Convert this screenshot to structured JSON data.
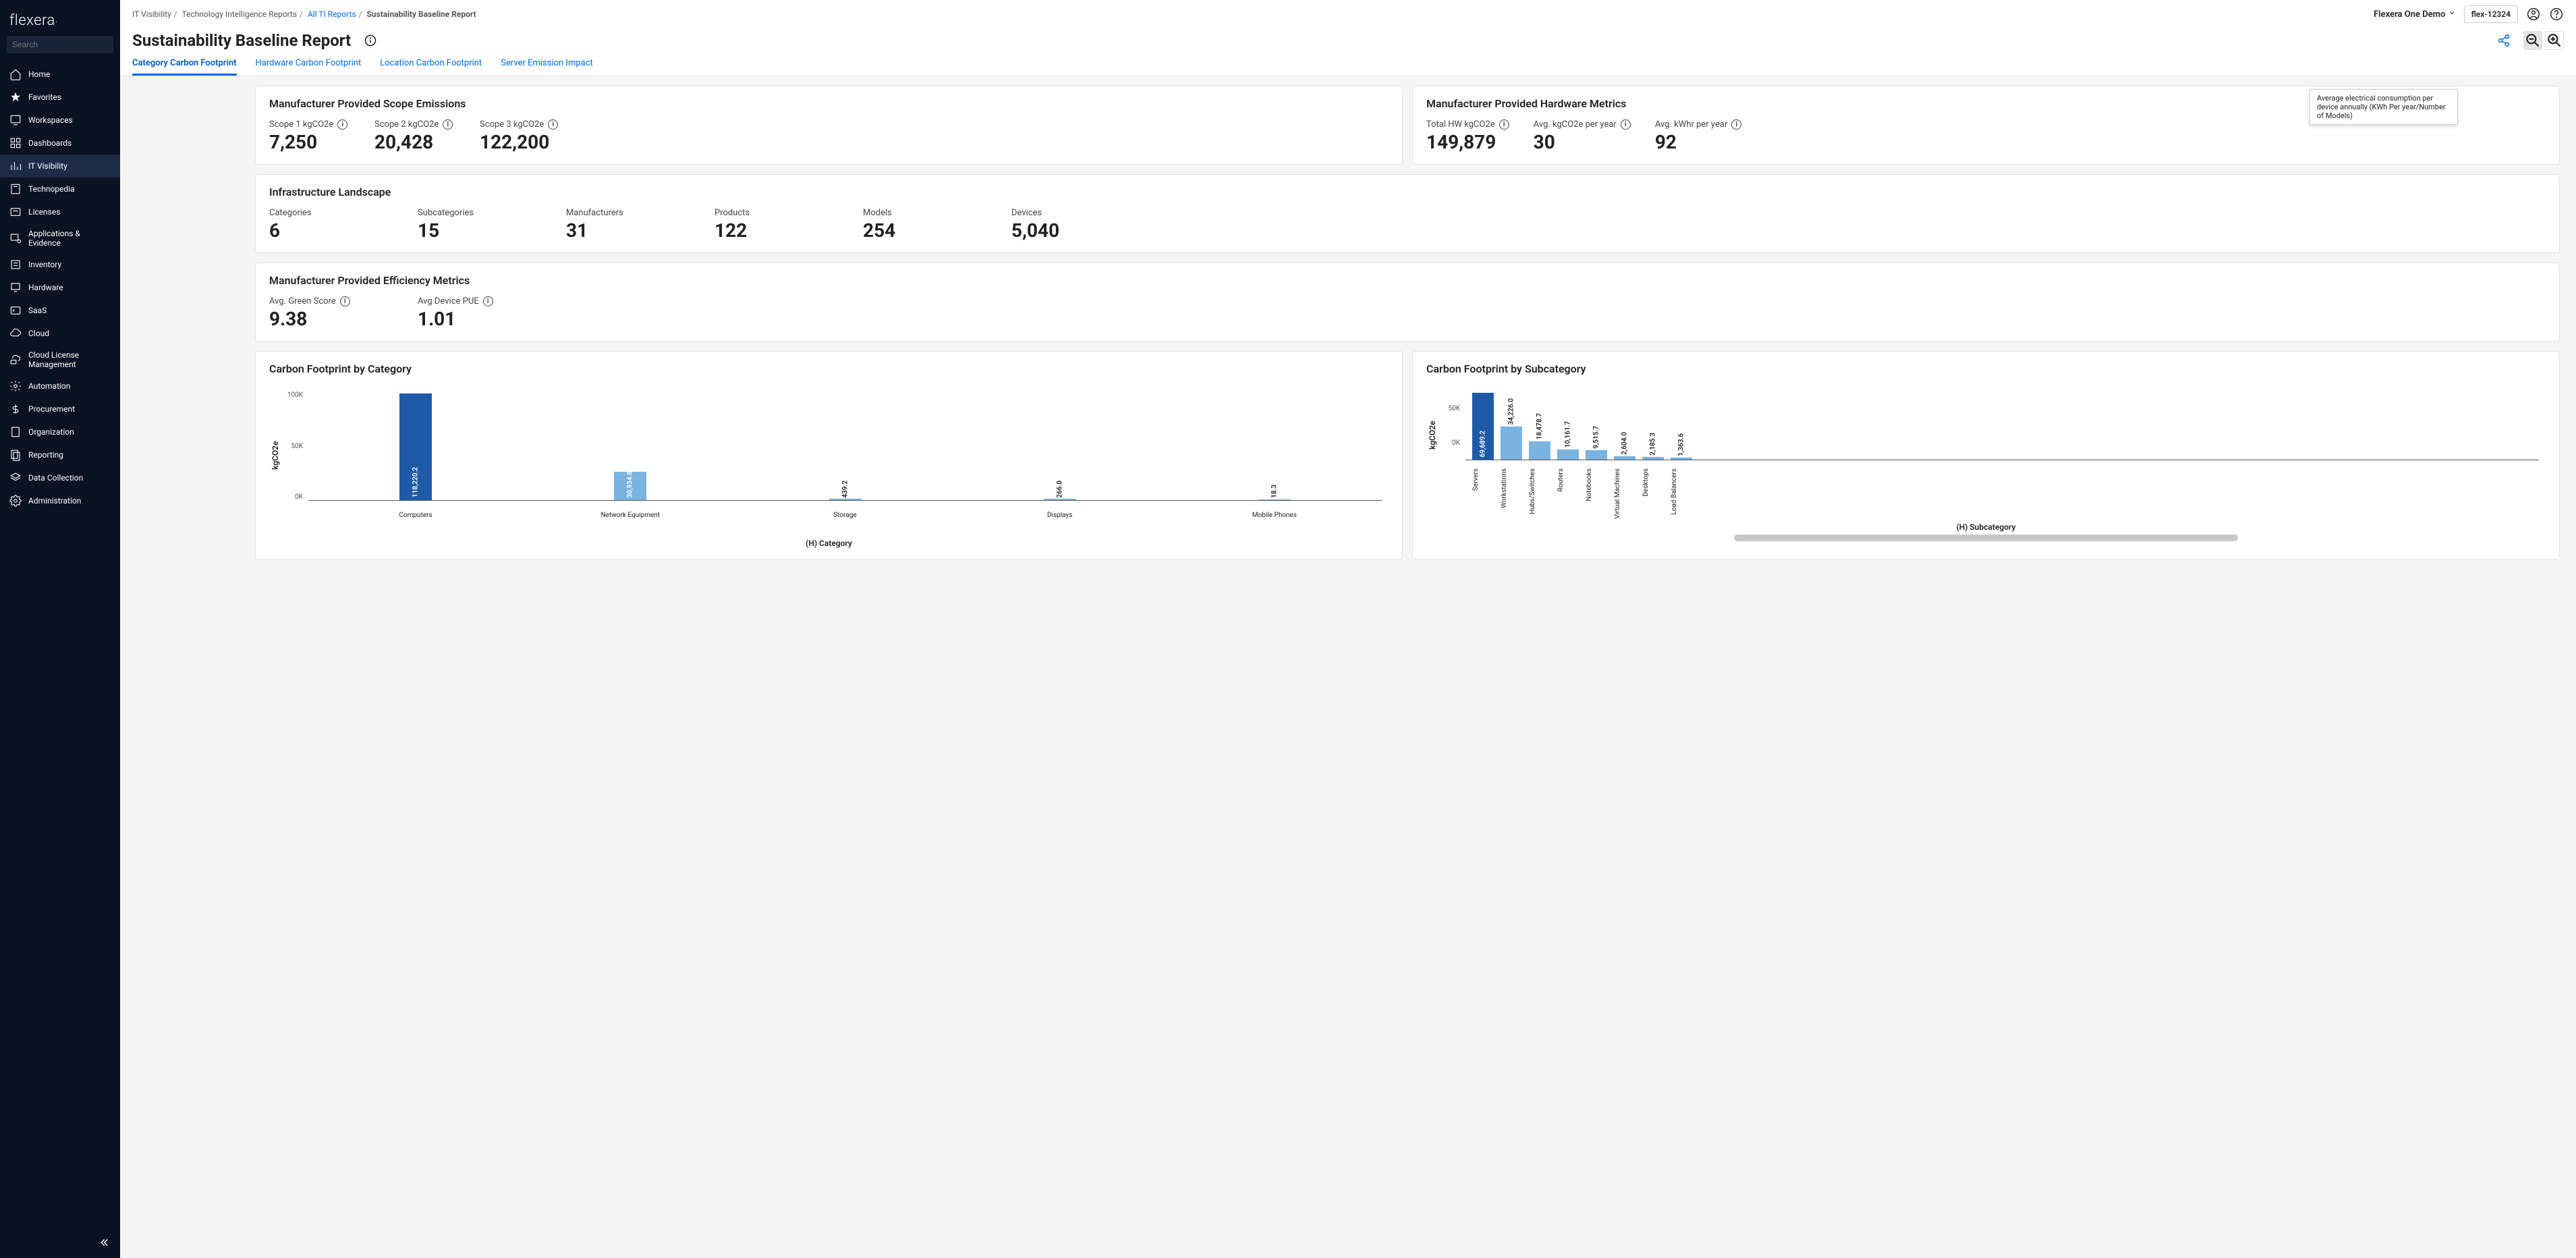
{
  "logo": "flexera",
  "search": {
    "placeholder": "Search"
  },
  "sidebar": {
    "items": [
      {
        "label": "Home"
      },
      {
        "label": "Favorites"
      },
      {
        "label": "Workspaces"
      },
      {
        "label": "Dashboards"
      },
      {
        "label": "IT Visibility"
      },
      {
        "label": "Technopedia"
      },
      {
        "label": "Licenses"
      },
      {
        "label": "Applications & Evidence"
      },
      {
        "label": "Inventory"
      },
      {
        "label": "Hardware"
      },
      {
        "label": "SaaS"
      },
      {
        "label": "Cloud"
      },
      {
        "label": "Cloud License Management"
      },
      {
        "label": "Automation"
      },
      {
        "label": "Procurement"
      },
      {
        "label": "Organization"
      },
      {
        "label": "Reporting"
      },
      {
        "label": "Data Collection"
      },
      {
        "label": "Administration"
      }
    ]
  },
  "breadcrumb": {
    "seg0": "IT Visibility",
    "seg1": "Technology Intelligence Reports",
    "seg2": "All TI Reports",
    "seg3": "Sustainability Baseline Report"
  },
  "top": {
    "org": "Flexera One Demo",
    "org_id": "flex-12324"
  },
  "page_title": "Sustainability Baseline Report",
  "tabs": [
    {
      "label": "Category Carbon Footprint"
    },
    {
      "label": "Hardware Carbon Footprint"
    },
    {
      "label": "Location Carbon Footprint"
    },
    {
      "label": "Server Emission Impact"
    }
  ],
  "cards": {
    "scope": {
      "title": "Manufacturer Provided Scope Emissions",
      "m": [
        {
          "label": "Scope 1 kgCO2e",
          "value": "7,250"
        },
        {
          "label": "Scope 2 kgCO2e",
          "value": "20,428"
        },
        {
          "label": "Scope 3 kgCO2e",
          "value": "122,200"
        }
      ]
    },
    "hw": {
      "title": "Manufacturer Provided Hardware Metrics",
      "m": [
        {
          "label": "Total HW kgCO2e",
          "value": "149,879"
        },
        {
          "label": "Avg. kgCO2e per year",
          "value": "30"
        },
        {
          "label": "Avg. kWhr per year",
          "value": "92"
        }
      ]
    },
    "infra": {
      "title": "Infrastructure Landscape",
      "m": [
        {
          "label": "Categories",
          "value": "6"
        },
        {
          "label": "Subcategories",
          "value": "15"
        },
        {
          "label": "Manufacturers",
          "value": "31"
        },
        {
          "label": "Products",
          "value": "122"
        },
        {
          "label": "Models",
          "value": "254"
        },
        {
          "label": "Devices",
          "value": "5,040"
        }
      ]
    },
    "eff": {
      "title": "Manufacturer Provided Efficiency Metrics",
      "m": [
        {
          "label": "Avg. Green Score",
          "value": "9.38"
        },
        {
          "label": "Avg Device PUE",
          "value": "1.01"
        }
      ]
    },
    "cat_chart": {
      "title": "Carbon Footprint by Category"
    },
    "sub_chart": {
      "title": "Carbon Footprint by Subcategory"
    }
  },
  "tooltip": "Average electrical consumption per device annually (KWh Per year/Number of Models)",
  "chart_data": [
    {
      "type": "bar",
      "title": "Carbon Footprint by Category",
      "xlabel": "(H) Category",
      "ylabel": "kgCO2e",
      "ylim": [
        0,
        120000
      ],
      "y_ticks": [
        "100K",
        "50K",
        "0K"
      ],
      "categories": [
        "Computers",
        "Network Equipment",
        "Storage",
        "Displays",
        "Mobile Phones"
      ],
      "values": [
        118220.2,
        30934.8,
        439.2,
        266.0,
        18.3
      ],
      "value_labels": [
        "118,220.2",
        "30,934.8",
        "439.2",
        "266.0",
        "18.3"
      ],
      "heights_pct": [
        98,
        26,
        1,
        1,
        0.5
      ],
      "colors": [
        "#1e5aa8",
        "#7ab2e0",
        "#7ab2e0",
        "#7ab2e0",
        "#7ab2e0"
      ]
    },
    {
      "type": "bar",
      "title": "Carbon Footprint by Subcategory",
      "xlabel": "(H) Subcategory",
      "ylabel": "kgCO2e",
      "ylim": [
        0,
        70000
      ],
      "y_ticks": [
        "50K",
        "0K"
      ],
      "categories": [
        "Servers",
        "Workstations",
        "Hubs/Switches",
        "Routers",
        "Notebooks",
        "Virtual Machines",
        "Desktops",
        "Load Balancers"
      ],
      "values": [
        69689.2,
        34226.0,
        18478.7,
        10161.7,
        9515.7,
        2604.0,
        2185.3,
        1363.6
      ],
      "value_labels": [
        "69,689.2",
        "34,226.0",
        "18,478.7",
        "10,161.7",
        "9,515.7",
        "2,604.0",
        "2,185.3",
        "1,363.6"
      ],
      "heights_pct": [
        98,
        49,
        27,
        15,
        14,
        5,
        4,
        3
      ]
    }
  ]
}
